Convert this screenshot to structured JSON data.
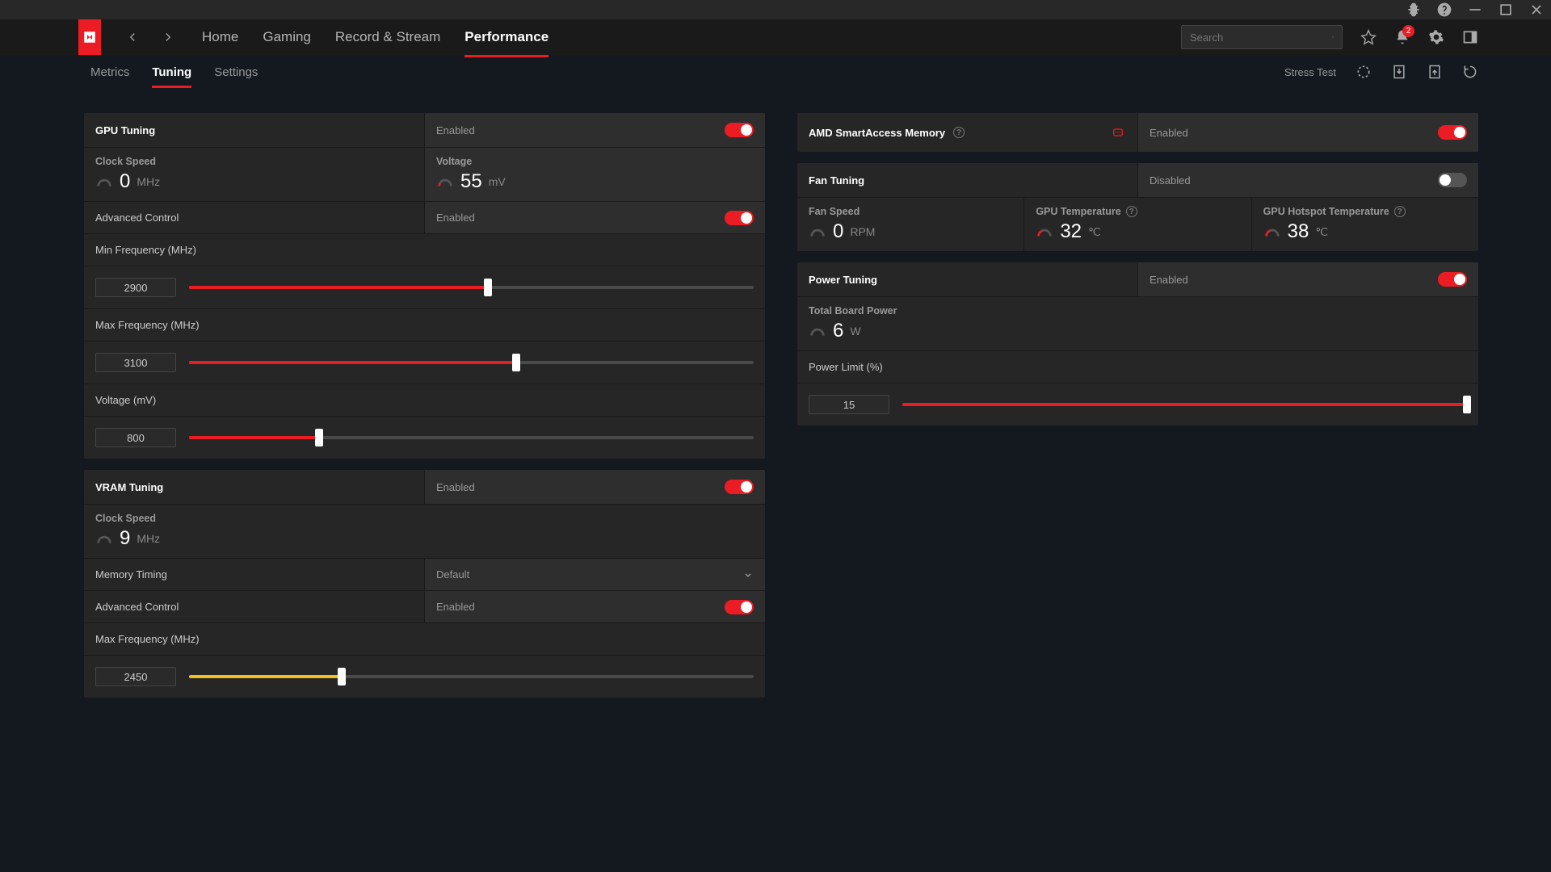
{
  "titlebar": {
    "notif_count": "2"
  },
  "nav": {
    "home": "Home",
    "gaming": "Gaming",
    "record": "Record & Stream",
    "performance": "Performance",
    "search_placeholder": "Search"
  },
  "subnav": {
    "metrics": "Metrics",
    "tuning": "Tuning",
    "settings": "Settings",
    "stress": "Stress Test"
  },
  "gpu": {
    "title": "GPU Tuning",
    "status": "Enabled",
    "clock_label": "Clock Speed",
    "clock_val": "0",
    "clock_unit": "MHz",
    "volt_label": "Voltage",
    "volt_val": "55",
    "volt_unit": "mV",
    "adv_label": "Advanced Control",
    "adv_status": "Enabled",
    "minf_label": "Min Frequency (MHz)",
    "minf_val": "2900",
    "minf_pct": 53,
    "maxf_label": "Max Frequency (MHz)",
    "maxf_val": "3100",
    "maxf_pct": 58,
    "voltmv_label": "Voltage (mV)",
    "voltmv_val": "800",
    "voltmv_pct": 23
  },
  "vram": {
    "title": "VRAM Tuning",
    "status": "Enabled",
    "clock_label": "Clock Speed",
    "clock_val": "9",
    "clock_unit": "MHz",
    "mem_label": "Memory Timing",
    "mem_val": "Default",
    "adv_label": "Advanced Control",
    "adv_status": "Enabled",
    "maxf_label": "Max Frequency (MHz)",
    "maxf_val": "2450",
    "maxf_pct": 27
  },
  "sam": {
    "title": "AMD SmartAccess Memory",
    "status": "Enabled"
  },
  "fan": {
    "title": "Fan Tuning",
    "status": "Disabled",
    "speed_label": "Fan Speed",
    "speed_val": "0",
    "speed_unit": "RPM",
    "temp_label": "GPU Temperature",
    "temp_val": "32",
    "temp_unit": "℃",
    "hot_label": "GPU Hotspot Temperature",
    "hot_val": "38",
    "hot_unit": "℃"
  },
  "power": {
    "title": "Power Tuning",
    "status": "Enabled",
    "tbp_label": "Total Board Power",
    "tbp_val": "6",
    "tbp_unit": "W",
    "limit_label": "Power Limit (%)",
    "limit_val": "15",
    "limit_pct": 100
  }
}
